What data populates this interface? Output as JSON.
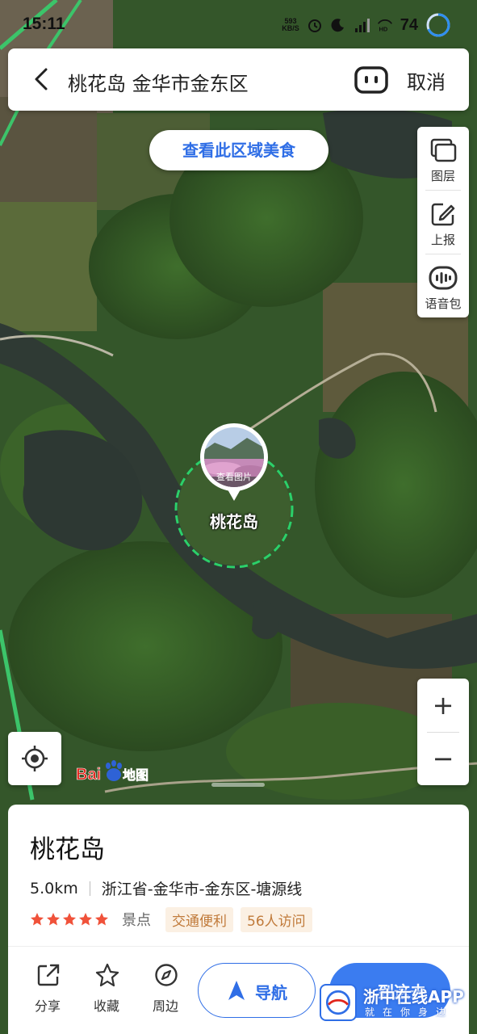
{
  "status_bar": {
    "time": "15:11",
    "net_speed_value": "593",
    "net_speed_unit": "KB/S",
    "battery": "74"
  },
  "search": {
    "query": "桃花岛 金华市金东区",
    "cancel_label": "取消"
  },
  "map": {
    "food_button_label": "查看此区域美食",
    "tools": [
      {
        "label": "图层",
        "icon": "layers-icon"
      },
      {
        "label": "上报",
        "icon": "report-edit-icon"
      },
      {
        "label": "语音包",
        "icon": "voice-pack-icon"
      }
    ],
    "zoom_in": "+",
    "zoom_out": "−",
    "marker_caption": "查看图片",
    "marker_label": "桃花岛",
    "logo_text_1": "Bai",
    "logo_text_2": "地图"
  },
  "place": {
    "name": "桃花岛",
    "distance": "5.0km",
    "address": "浙江省-金华市-金东区-塘源线",
    "rating_stars": 5,
    "category": "景点",
    "tags": [
      "交通便利",
      "56人访问"
    ]
  },
  "actions": {
    "share": "分享",
    "favorite": "收藏",
    "nearby": "周边",
    "navigate": "导航",
    "go": "到这去"
  },
  "watermark": {
    "title": "浙中在线APP",
    "subtitle": "就在你身边"
  },
  "colors": {
    "accent": "#2f6ee6",
    "star": "#f0523a",
    "tag_text": "#c07a3a",
    "geofence": "#2bd06a"
  }
}
